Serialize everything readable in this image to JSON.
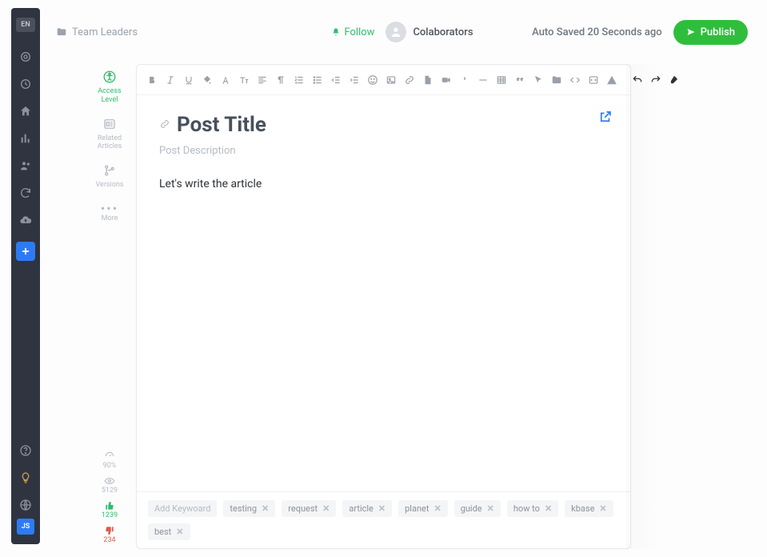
{
  "rail": {
    "lang_badge": "EN",
    "icons": [
      {
        "name": "target-icon"
      },
      {
        "name": "history-icon"
      },
      {
        "name": "home-icon"
      },
      {
        "name": "analytics-icon"
      },
      {
        "name": "users-icon"
      },
      {
        "name": "sync-icon"
      },
      {
        "name": "cloud-upload-icon"
      }
    ],
    "bottom_icons": [
      {
        "name": "help-icon"
      },
      {
        "name": "tips-icon",
        "highlight": true
      },
      {
        "name": "globe-icon"
      }
    ],
    "js_badge": "JS"
  },
  "topbar": {
    "breadcrumb": "Team Leaders",
    "follow_label": "Follow",
    "collaborators_label": "Colaborators",
    "autosaved_label": "Auto Saved 20 Seconds ago",
    "publish_label": "Publish"
  },
  "mini_panel": {
    "items": [
      {
        "name": "access-level",
        "label": "Access Level",
        "icon": "accessibility-icon",
        "active": true
      },
      {
        "name": "related-articles",
        "label": "Related Articles",
        "icon": "articles-icon"
      },
      {
        "name": "versions",
        "label": "Versions",
        "icon": "branch-icon"
      },
      {
        "name": "more",
        "label": "More",
        "icon": "more-icon"
      }
    ]
  },
  "stats": {
    "health_pct": "90%",
    "views": "5129",
    "upvotes": "1239",
    "downvotes": "234"
  },
  "toolbar": {
    "buttons": [
      {
        "name": "bold-icon"
      },
      {
        "name": "italic-icon"
      },
      {
        "name": "underline-icon"
      },
      {
        "name": "fill-color-icon"
      },
      {
        "name": "font-icon"
      },
      {
        "name": "text-size-icon"
      },
      {
        "name": "align-icon"
      },
      {
        "name": "paragraph-icon"
      },
      {
        "name": "list-ordered-icon"
      },
      {
        "name": "list-unordered-icon"
      },
      {
        "name": "indent-decrease-icon"
      },
      {
        "name": "indent-increase-icon"
      },
      {
        "name": "emoji-icon"
      },
      {
        "name": "image-icon"
      },
      {
        "name": "link-icon"
      },
      {
        "name": "file-icon"
      },
      {
        "name": "video-icon"
      },
      {
        "name": "special-char-icon"
      },
      {
        "name": "hr-icon"
      },
      {
        "name": "table-icon"
      },
      {
        "name": "quote-icon"
      },
      {
        "name": "cursor-icon"
      },
      {
        "name": "folder-icon"
      },
      {
        "name": "code-icon"
      },
      {
        "name": "embed-icon"
      },
      {
        "name": "warning-icon"
      }
    ],
    "right_buttons": [
      {
        "name": "undo-icon"
      },
      {
        "name": "redo-icon"
      },
      {
        "name": "clear-format-icon"
      }
    ]
  },
  "doc": {
    "title_placeholder": "Post Title",
    "desc_placeholder": "Post Description",
    "body_text": "Let's write the article"
  },
  "tags": {
    "input_placeholder": "Add Keywoard",
    "items": [
      {
        "label": "testing"
      },
      {
        "label": "request"
      },
      {
        "label": "article"
      },
      {
        "label": "planet"
      },
      {
        "label": "guide"
      },
      {
        "label": "how to"
      },
      {
        "label": "kbase"
      },
      {
        "label": "best"
      }
    ]
  }
}
